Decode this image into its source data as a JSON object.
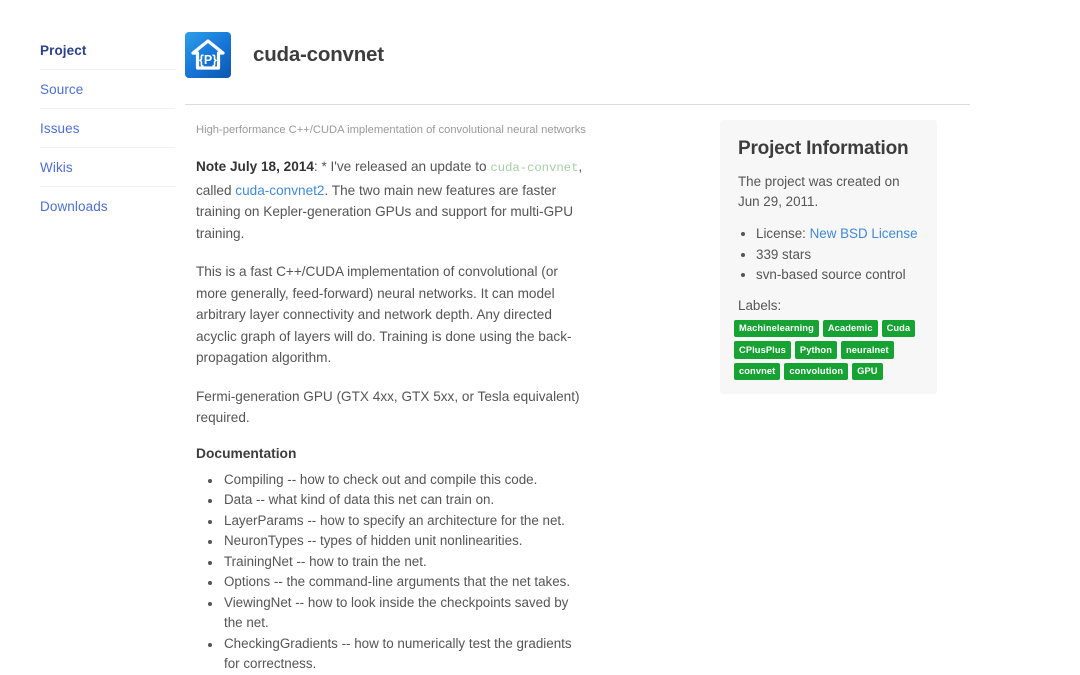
{
  "nav": {
    "items": [
      {
        "label": "Project",
        "active": true
      },
      {
        "label": "Source",
        "active": false
      },
      {
        "label": "Issues",
        "active": false
      },
      {
        "label": "Wikis",
        "active": false
      },
      {
        "label": "Downloads",
        "active": false
      }
    ]
  },
  "header": {
    "title": "cuda-convnet",
    "logo_text": "{P}",
    "logo_icon": "house-icon"
  },
  "content": {
    "short_description": "High-performance C++/CUDA implementation of convolutional neural networks",
    "note": {
      "bold_prefix": "Note July 18, 2014",
      "after_prefix": ": * I've released an update to ",
      "code_link": "cuda-convnet",
      "mid": ", called ",
      "link2": "cuda-convnet2",
      "tail": ". The two main new features are faster training on Kepler-generation GPUs and support for multi-GPU training."
    },
    "paragraph_2": "This is a fast C++/CUDA implementation of convolutional (or more generally, feed-forward) neural networks. It can model arbitrary layer connectivity and network depth. Any directed acyclic graph of layers will do. Training is done using the back-propagation algorithm.",
    "paragraph_3": "Fermi-generation GPU (GTX 4xx, GTX 5xx, or Tesla equivalent) required.",
    "documentation_heading": "Documentation",
    "documentation_items": [
      "Compiling -- how to check out and compile this code.",
      "Data -- what kind of data this net can train on.",
      "LayerParams -- how to specify an architecture for the net.",
      "NeuronTypes -- types of hidden unit nonlinearities.",
      "TrainingNet -- how to train the net.",
      "Options -- the command-line arguments that the net takes.",
      "ViewingNet -- how to look inside the checkpoints saved by the net.",
      "CheckingGradients -- how to numerically test the gradients for correctness."
    ]
  },
  "info_panel": {
    "title": "Project Information",
    "created_text": "The project was created on Jun 29, 2011.",
    "facts": [
      {
        "prefix": "License: ",
        "link": "New BSD License"
      },
      {
        "prefix": "339 stars",
        "link": ""
      },
      {
        "prefix": "svn-based source control",
        "link": ""
      }
    ],
    "labels_heading": "Labels:",
    "labels": [
      "Machinelearning",
      "Academic",
      "Cuda",
      "CPlusPlus",
      "Python",
      "neuralnet",
      "convnet",
      "convolution",
      "GPU"
    ]
  },
  "colors": {
    "label_green": "#17a333",
    "link_blue": "#4189d8",
    "nav_blue": "#4d6fd4",
    "nav_active_blue": "#29418f",
    "panel_bg": "#f7f7f7",
    "logo_blue": "#1574d6"
  }
}
